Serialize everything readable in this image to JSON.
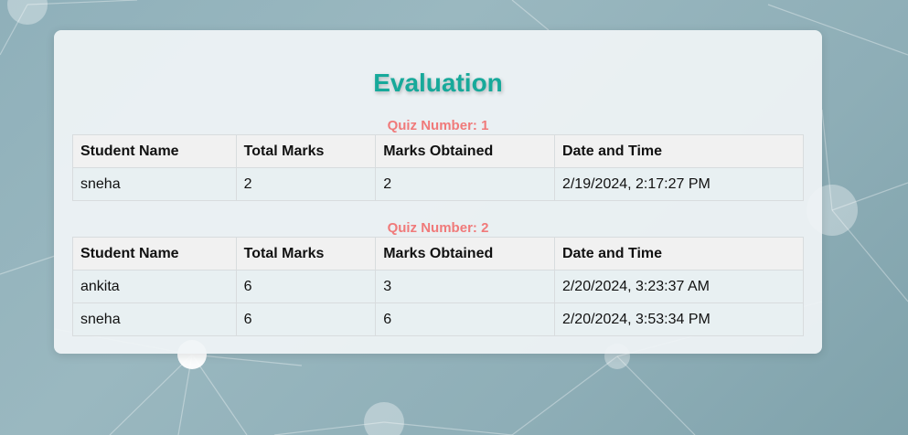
{
  "page": {
    "title": "Evaluation"
  },
  "colors": {
    "title": "#17a99a",
    "quiz_label": "#f07a7a",
    "header_bg": "#f1f1f1"
  },
  "table_headers": [
    "Student Name",
    "Total Marks",
    "Marks Obtained",
    "Date and Time"
  ],
  "quizzes": [
    {
      "label": "Quiz Number: 1",
      "rows": [
        [
          "sneha",
          "2",
          "2",
          "2/19/2024, 2:17:27 PM"
        ]
      ]
    },
    {
      "label": "Quiz Number: 2",
      "rows": [
        [
          "ankita",
          "6",
          "3",
          "2/20/2024, 3:23:37 AM"
        ],
        [
          "sneha",
          "6",
          "6",
          "2/20/2024, 3:53:34 PM"
        ]
      ]
    }
  ]
}
